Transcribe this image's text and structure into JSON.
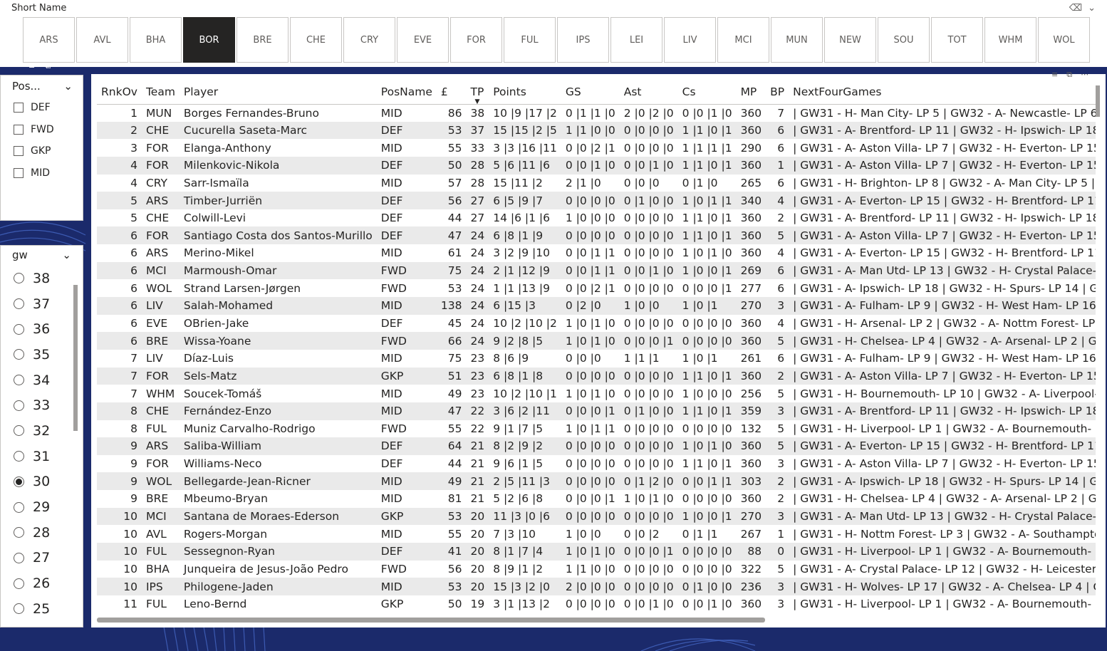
{
  "team_slicer": {
    "title": "Short Name",
    "teams": [
      "ARS",
      "AVL",
      "BHA",
      "BOR",
      "BRE",
      "CHE",
      "CRY",
      "EVE",
      "FOR",
      "FUL",
      "IPS",
      "LEI",
      "LIV",
      "MCI",
      "MUN",
      "NEW",
      "SOU",
      "TOT",
      "WHM",
      "WOL"
    ],
    "selected": "BOR"
  },
  "pos_slicer": {
    "title": "Pos...",
    "options": [
      "DEF",
      "FWD",
      "GKP",
      "MID"
    ]
  },
  "gw_slicer": {
    "title": "gw",
    "options": [
      "38",
      "37",
      "36",
      "35",
      "34",
      "33",
      "32",
      "31",
      "30",
      "29",
      "28",
      "27",
      "26",
      "25"
    ],
    "selected": "30"
  },
  "table": {
    "columns": [
      "RnkOv",
      "Team",
      "Player",
      "PosName",
      "£",
      "TP",
      "Points",
      "GS",
      "Ast",
      "Cs",
      "MP",
      "BP",
      "NextFourGames"
    ],
    "rows": [
      [
        "1",
        "MUN",
        "Borges Fernandes-Bruno",
        "MID",
        "86",
        "38",
        "10 |9 |17 |2",
        "0 |1 |1 |0",
        "2 |0 |2 |0",
        "0 |0 |1 |0",
        "360",
        "7",
        "| GW31 - H- Man City- LP 5 | GW32 - A- Newcastle- LP 6 | GW"
      ],
      [
        "2",
        "CHE",
        "Cucurella Saseta-Marc",
        "DEF",
        "53",
        "37",
        "15 |15 |2 |5",
        "1 |1 |0 |0",
        "0 |0 |0 |0",
        "1 |1 |0 |1",
        "360",
        "6",
        "| GW31 - A- Brentford- LP 11 | GW32 - H- Ipswich- LP 18 | GV"
      ],
      [
        "3",
        "FOR",
        "Elanga-Anthony",
        "MID",
        "55",
        "33",
        "3 |3 |16 |11",
        "0 |0 |2 |1",
        "0 |0 |0 |0",
        "1 |1 |1 |1",
        "290",
        "6",
        "| GW31 - A- Aston Villa- LP 7 | GW32 - H- Everton- LP 15 | GV"
      ],
      [
        "4",
        "FOR",
        "Milenkovic-Nikola",
        "DEF",
        "50",
        "28",
        "5 |6 |11 |6",
        "0 |0 |1 |0",
        "0 |0 |1 |0",
        "1 |1 |0 |1",
        "360",
        "1",
        "| GW31 - A- Aston Villa- LP 7 | GW32 - H- Everton- LP 15 | GV"
      ],
      [
        "4",
        "CRY",
        "Sarr-Ismaïla",
        "MID",
        "57",
        "28",
        "15 |11 |2",
        "2 |1 |0",
        "0 |0 |0",
        "0 |1 |0",
        "265",
        "6",
        "| GW31 - H- Brighton- LP 8 | GW32 - A- Man City- LP 5 | GW3"
      ],
      [
        "5",
        "ARS",
        "Timber-Jurriën",
        "DEF",
        "56",
        "27",
        "6 |5 |9 |7",
        "0 |0 |0 |0",
        "0 |1 |0 |0",
        "1 |0 |1 |1",
        "340",
        "4",
        "| GW31 - A- Everton- LP 15 | GW32 - H- Brentford- LP 11 | GV"
      ],
      [
        "5",
        "CHE",
        "Colwill-Levi",
        "DEF",
        "44",
        "27",
        "14 |6 |1 |6",
        "1 |0 |0 |0",
        "0 |0 |0 |0",
        "1 |1 |0 |1",
        "360",
        "2",
        "| GW31 - A- Brentford- LP 11 | GW32 - H- Ipswich- LP 18 | GV"
      ],
      [
        "6",
        "FOR",
        "Santiago Costa dos Santos-Murillo",
        "DEF",
        "47",
        "24",
        "6 |8 |1 |9",
        "0 |0 |0 |0",
        "0 |0 |0 |0",
        "1 |1 |0 |1",
        "360",
        "5",
        "| GW31 - A- Aston Villa- LP 7 | GW32 - H- Everton- LP 15 | GV"
      ],
      [
        "6",
        "ARS",
        "Merino-Mikel",
        "MID",
        "61",
        "24",
        "3 |2 |9 |10",
        "0 |0 |1 |1",
        "0 |0 |0 |0",
        "1 |0 |1 |0",
        "360",
        "4",
        "| GW31 - A- Everton- LP 15 | GW32 - H- Brentford- LP 11 | GV"
      ],
      [
        "6",
        "MCI",
        "Marmoush-Omar",
        "FWD",
        "75",
        "24",
        "2 |1 |12 |9",
        "0 |0 |1 |1",
        "0 |0 |1 |0",
        "1 |0 |0 |1",
        "269",
        "6",
        "| GW31 - A- Man Utd- LP 13 | GW32 - H- Crystal Palace- LP 1"
      ],
      [
        "6",
        "WOL",
        "Strand Larsen-Jørgen",
        "FWD",
        "53",
        "24",
        "1 |1 |13 |9",
        "0 |0 |2 |1",
        "0 |0 |0 |0",
        "0 |0 |0 |1",
        "277",
        "6",
        "| GW31 - A- Ipswich- LP 18 | GW32 - H- Spurs- LP 14 | GW33"
      ],
      [
        "6",
        "LIV",
        "Salah-Mohamed",
        "MID",
        "138",
        "24",
        "6 |15 |3",
        "0 |2 |0",
        "1 |0 |0",
        "1 |0 |1",
        "270",
        "3",
        "| GW31 - A- Fulham- LP 9 | GW32 - H- West Ham- LP 16 | GV"
      ],
      [
        "6",
        "EVE",
        "OBrien-Jake",
        "DEF",
        "45",
        "24",
        "10 |2 |10 |2",
        "1 |0 |1 |0",
        "0 |0 |0 |0",
        "0 |0 |0 |0",
        "360",
        "4",
        "| GW31 - H- Arsenal- LP 2 | GW32 - A- Nottm Forest- LP 3 | C"
      ],
      [
        "6",
        "BRE",
        "Wissa-Yoane",
        "FWD",
        "66",
        "24",
        "9 |2 |8 |5",
        "1 |0 |1 |0",
        "0 |0 |0 |1",
        "0 |0 |0 |0",
        "360",
        "5",
        "| GW31 - H- Chelsea- LP 4 | GW32 - A- Arsenal- LP 2 | GW33"
      ],
      [
        "7",
        "LIV",
        "Díaz-Luis",
        "MID",
        "75",
        "23",
        "8 |6 |9",
        "0 |0 |0",
        "1 |1 |1",
        "1 |0 |1",
        "261",
        "6",
        "| GW31 - A- Fulham- LP 9 | GW32 - H- West Ham- LP 16 | GV"
      ],
      [
        "7",
        "FOR",
        "Sels-Matz",
        "GKP",
        "51",
        "23",
        "6 |8 |1 |8",
        "0 |0 |0 |0",
        "0 |0 |0 |0",
        "1 |1 |0 |1",
        "360",
        "2",
        "| GW31 - A- Aston Villa- LP 7 | GW32 - H- Everton- LP 15 | GV"
      ],
      [
        "7",
        "WHM",
        "Soucek-Tomáš",
        "MID",
        "49",
        "23",
        "10 |2 |10 |1",
        "1 |0 |1 |0",
        "0 |0 |0 |0",
        "1 |0 |0 |0",
        "256",
        "5",
        "| GW31 - H- Bournemouth- LP 10 | GW32 - A- Liverpool- LP"
      ],
      [
        "8",
        "CHE",
        "Fernández-Enzo",
        "MID",
        "47",
        "22",
        "3 |6 |2 |11",
        "0 |0 |0 |1",
        "0 |1 |0 |0",
        "1 |1 |0 |1",
        "359",
        "3",
        "| GW31 - A- Brentford- LP 11 | GW32 - H- Ipswich- LP 18 | GV"
      ],
      [
        "8",
        "FUL",
        "Muniz Carvalho-Rodrigo",
        "FWD",
        "55",
        "22",
        "9 |1 |7 |5",
        "1 |0 |1 |1",
        "0 |0 |0 |0",
        "0 |0 |0 |0",
        "132",
        "5",
        "| GW31 - H- Liverpool- LP 1 | GW32 - A- Bournemouth- LP 1("
      ],
      [
        "9",
        "ARS",
        "Saliba-William",
        "DEF",
        "64",
        "21",
        "8 |2 |9 |2",
        "0 |0 |0 |0",
        "0 |0 |0 |0",
        "1 |0 |1 |0",
        "360",
        "5",
        "| GW31 - A- Everton- LP 15 | GW32 - H- Brentford- LP 11 | GV"
      ],
      [
        "9",
        "FOR",
        "Williams-Neco",
        "DEF",
        "44",
        "21",
        "9 |6 |1 |5",
        "0 |0 |0 |0",
        "0 |0 |0 |0",
        "1 |1 |0 |1",
        "360",
        "3",
        "| GW31 - A- Aston Villa- LP 7 | GW32 - H- Everton- LP 15 | GV"
      ],
      [
        "9",
        "WOL",
        "Bellegarde-Jean-Ricner",
        "MID",
        "49",
        "21",
        "2 |5 |11 |3",
        "0 |0 |0 |0",
        "0 |1 |2 |0",
        "0 |0 |1 |1",
        "303",
        "2",
        "| GW31 - A- Ipswich- LP 18 | GW32 - H- Spurs- LP 14 | GW33"
      ],
      [
        "9",
        "BRE",
        "Mbeumo-Bryan",
        "MID",
        "81",
        "21",
        "5 |2 |6 |8",
        "0 |0 |0 |1",
        "1 |0 |1 |0",
        "0 |0 |0 |0",
        "360",
        "2",
        "| GW31 - H- Chelsea- LP 4 | GW32 - A- Arsenal- LP 2 | GW33"
      ],
      [
        "10",
        "MCI",
        "Santana de Moraes-Ederson",
        "GKP",
        "53",
        "20",
        "11 |3 |0 |6",
        "0 |0 |0 |0",
        "0 |0 |0 |0",
        "1 |0 |0 |1",
        "270",
        "3",
        "| GW31 - A- Man Utd- LP 13 | GW32 - H- Crystal Palace- LP 1"
      ],
      [
        "10",
        "AVL",
        "Rogers-Morgan",
        "MID",
        "55",
        "20",
        "7 |3 |10",
        "1 |0 |0",
        "0 |0 |2",
        "0 |1 |1",
        "267",
        "1",
        "| GW31 - H- Nottm Forest- LP 3 | GW32 - A- Southampton- L"
      ],
      [
        "10",
        "FUL",
        "Sessegnon-Ryan",
        "DEF",
        "41",
        "20",
        "8 |1 |7 |4",
        "1 |0 |1 |0",
        "0 |0 |0 |1",
        "0 |0 |0 |0",
        "88",
        "0",
        "| GW31 - H- Liverpool- LP 1 | GW32 - A- Bournemouth- LP 1("
      ],
      [
        "10",
        "BHA",
        "Junqueira de Jesus-João Pedro",
        "FWD",
        "56",
        "20",
        "8 |9 |1 |2",
        "1 |1 |0 |0",
        "0 |0 |0 |0",
        "0 |0 |0 |0",
        "322",
        "5",
        "| GW31 - A- Crystal Palace- LP 12 | GW32 - H- Leicester- LP 1"
      ],
      [
        "10",
        "IPS",
        "Philogene-Jaden",
        "MID",
        "53",
        "20",
        "15 |3 |2 |0",
        "2 |0 |0 |0",
        "0 |0 |0 |0",
        "0 |1 |0 |0",
        "236",
        "3",
        "| GW31 - H- Wolves- LP 17 | GW32 - A- Chelsea- LP 4 | GW33"
      ],
      [
        "11",
        "FUL",
        "Leno-Bernd",
        "GKP",
        "50",
        "19",
        "3 |1 |13 |2",
        "0 |0 |0 |0",
        "0 |0 |1 |0",
        "0 |0 |1 |0",
        "360",
        "3",
        "| GW31 - H- Liverpool- LP 1 | GW32 - A- Bournemouth- LP 1("
      ]
    ]
  }
}
